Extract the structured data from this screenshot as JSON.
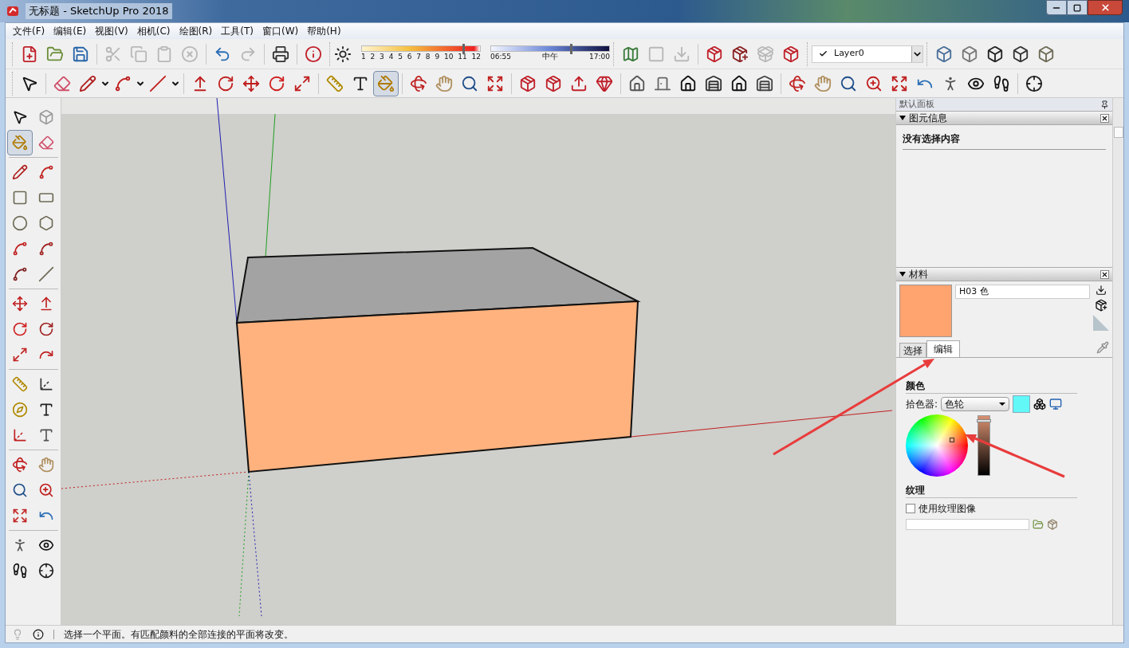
{
  "window": {
    "title": "无标题 - SketchUp Pro 2018"
  },
  "menu": [
    "文件(F)",
    "编辑(E)",
    "视图(V)",
    "相机(C)",
    "绘图(R)",
    "工具(T)",
    "窗口(W)",
    "帮助(H)"
  ],
  "toolbar_1": [
    [
      {
        "disabled": false
      },
      {
        "disabled": false
      },
      {
        "disabled": false
      }
    ],
    [
      {
        "disabled": true
      },
      {
        "disabled": true
      },
      {
        "disabled": true
      },
      {
        "disabled": true
      }
    ],
    [
      {
        "disabled": false
      },
      {
        "disabled": true
      }
    ],
    [
      {
        "disabled": false
      }
    ],
    [
      {
        "disabled": false
      }
    ]
  ],
  "shadows": {
    "months": [
      "1",
      "2",
      "3",
      "4",
      "5",
      "6",
      "7",
      "8",
      "9",
      "10",
      "11",
      "12"
    ],
    "month_slider": {
      "level": 0.85
    },
    "time_start": "06:55",
    "time_mid": "中午",
    "time_end": "17:00",
    "time_slider": {
      "level": 0.67
    }
  },
  "toolbar_1b": [
    [
      {
        "disabled": false
      },
      {
        "disabled": true
      },
      {
        "disabled": true
      }
    ],
    [
      {
        "disabled": false
      },
      {
        "disabled": false
      },
      {
        "disabled": true
      },
      {
        "disabled": false
      }
    ]
  ],
  "layer": {
    "name": "Layer0",
    "checked": true
  },
  "toolbar_2": [
    [
      {
        "selected": false
      }
    ],
    [
      {
        "selected": false
      },
      {
        "selected": false
      },
      {
        "selected": false
      },
      {
        "selected": false
      }
    ],
    [
      {
        "selected": false
      },
      {
        "selected": false
      },
      {
        "selected": false
      },
      {
        "selected": false
      },
      {
        "selected": false
      }
    ],
    [
      {
        "selected": false
      },
      {
        "selected": false
      },
      {
        "selected": true
      }
    ],
    [
      {
        "selected": false
      },
      {
        "selected": false
      },
      {
        "selected": false
      },
      {
        "selected": false
      }
    ],
    [
      {
        "selected": false
      },
      {
        "selected": false
      },
      {
        "selected": false
      },
      {
        "selected": false
      }
    ],
    [
      {
        "selected": false
      },
      {
        "selected": false
      },
      {
        "selected": false
      },
      {
        "selected": false
      },
      {
        "selected": false
      },
      {
        "selected": false
      }
    ],
    [
      {
        "selected": false
      },
      {
        "selected": false
      },
      {
        "selected": false
      },
      {
        "selected": false
      },
      {
        "selected": false
      },
      {
        "selected": false
      },
      {
        "selected": false
      },
      {
        "selected": false
      },
      {
        "selected": false
      }
    ],
    [
      {
        "selected": false
      }
    ]
  ],
  "palette": [
    [
      {
        "selected": false
      },
      {
        "selected": false
      },
      {
        "selected": true
      },
      {
        "selected": false
      }
    ],
    [
      {
        "selected": false
      },
      {
        "selected": false
      },
      {
        "selected": false
      },
      {
        "selected": false
      },
      {
        "selected": false
      },
      {
        "selected": false
      },
      {
        "selected": false
      },
      {
        "selected": false
      },
      {
        "selected": false
      },
      {
        "selected": false
      }
    ],
    [
      {
        "selected": false
      },
      {
        "selected": false
      },
      {
        "selected": false
      },
      {
        "selected": false
      },
      {
        "selected": false
      },
      {
        "selected": false
      }
    ],
    [
      {
        "selected": false
      },
      {
        "selected": false
      },
      {
        "selected": false
      },
      {
        "selected": false
      },
      {
        "selected": false
      },
      {
        "selected": false
      }
    ],
    [
      {
        "selected": false
      },
      {
        "selected": false
      },
      {
        "selected": false
      },
      {
        "selected": false
      },
      {
        "selected": false
      },
      {
        "selected": false
      }
    ],
    [
      {
        "selected": false
      },
      {
        "selected": false
      },
      {
        "selected": false
      },
      {
        "selected": false
      }
    ]
  ],
  "panel": {
    "title": "默认面板",
    "entity_info": {
      "title": "图元信息",
      "expanded": true,
      "text": "没有选择内容"
    },
    "materials": {
      "title": "材料",
      "expanded": true,
      "name": "H03 色",
      "tabs": [
        {
          "label": "选择",
          "selected": false
        },
        {
          "label": "编辑",
          "selected": true
        }
      ],
      "color_heading": "颜色",
      "picker_label": "拾色器:",
      "picker_value": "色轮",
      "brightness_slider": {
        "level": 0.95
      },
      "texture_heading": "纹理",
      "use_texture": {
        "label": "使用纹理图像",
        "checked": false
      }
    }
  },
  "status_bar": {
    "text": "选择一个平面。有匹配颜料的全部连接的平面将改变。"
  }
}
